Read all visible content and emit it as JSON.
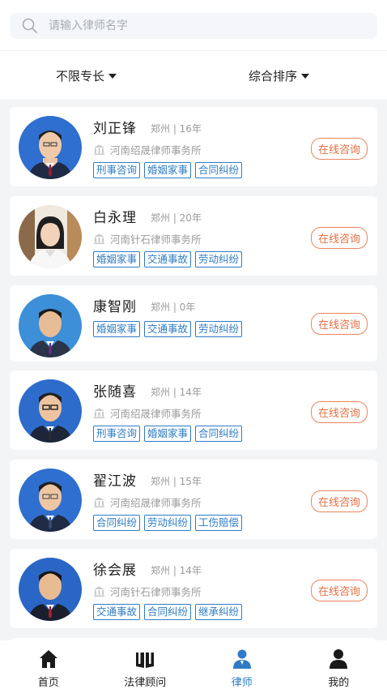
{
  "search": {
    "placeholder": "请输入律师名字"
  },
  "filters": {
    "specialty": "不限专长",
    "sort": "综合排序"
  },
  "consult_label": "在线咨询",
  "colors": {
    "accent": "#2f7cc4",
    "consult": "#e66f42"
  },
  "lawyers": [
    {
      "name": "刘正锋",
      "meta": "郑州 | 16年",
      "firm": "河南绍晟律师事务所",
      "tags": [
        "刑事咨询",
        "婚姻家事",
        "合同纠纷"
      ]
    },
    {
      "name": "白永理",
      "meta": "郑州 | 20年",
      "firm": "河南针石律师事务所",
      "tags": [
        "婚姻家事",
        "交通事故",
        "劳动纠纷"
      ]
    },
    {
      "name": "康智刚",
      "meta": "郑州 | 0年",
      "firm": "",
      "tags": [
        "婚姻家事",
        "交通事故",
        "劳动纠纷"
      ]
    },
    {
      "name": "张随喜",
      "meta": "郑州 | 14年",
      "firm": "河南绍晟律师事务所",
      "tags": [
        "刑事咨询",
        "婚姻家事",
        "合同纠纷"
      ]
    },
    {
      "name": "翟江波",
      "meta": "郑州 | 15年",
      "firm": "河南绍晟律师事务所",
      "tags": [
        "合同纠纷",
        "劳动纠纷",
        "工伤赔偿"
      ]
    },
    {
      "name": "徐会展",
      "meta": "郑州 | 14年",
      "firm": "河南针石律师事务所",
      "tags": [
        "交通事故",
        "合同纠纷",
        "继承纠纷"
      ]
    }
  ],
  "tabbar": [
    {
      "label": "首页",
      "icon": "home-icon"
    },
    {
      "label": "法律顾问",
      "icon": "book-icon"
    },
    {
      "label": "律师",
      "icon": "lawyer-icon"
    },
    {
      "label": "我的",
      "icon": "user-icon"
    }
  ]
}
